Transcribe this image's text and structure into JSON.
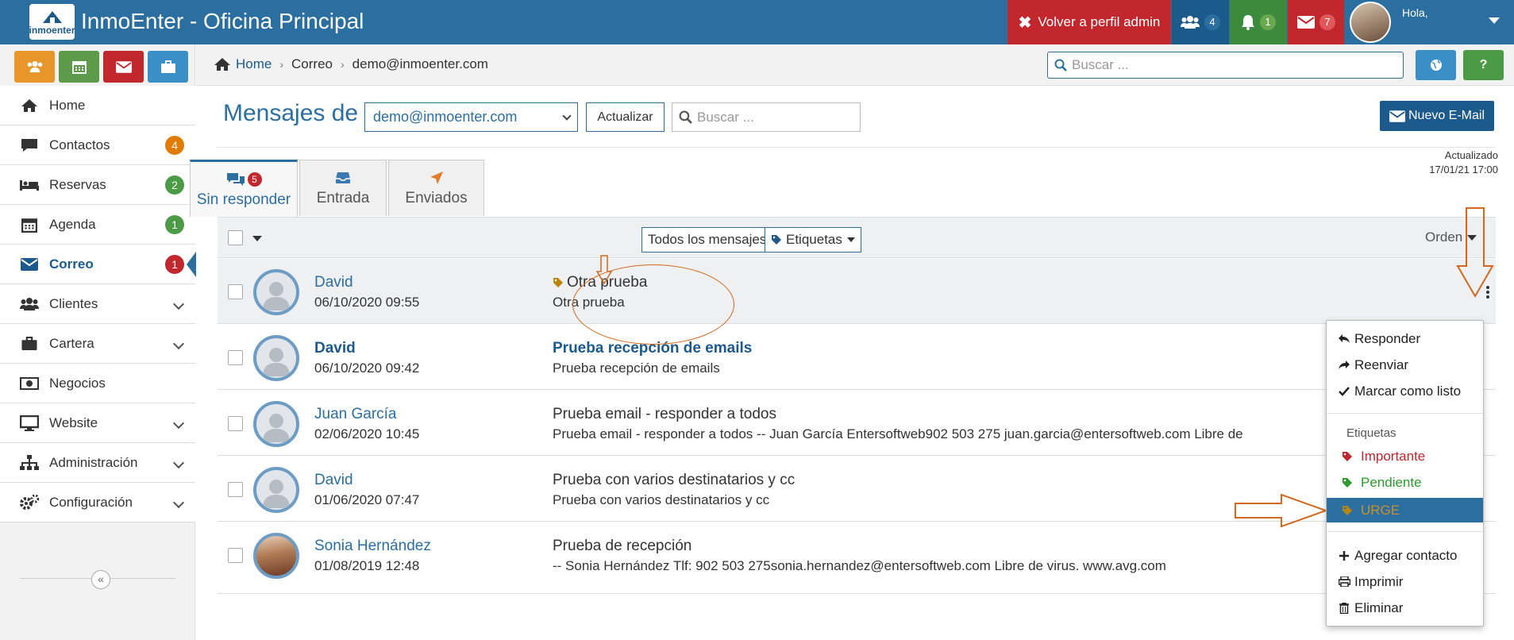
{
  "app": {
    "title": "InmoEnter - Oficina Principal",
    "logo_text": "inmoenter"
  },
  "topbar": {
    "admin_label": "Volver a perfil admin",
    "users_count": "4",
    "notif_count": "1",
    "mail_count": "7",
    "greeting": "Hola,"
  },
  "breadcrumb": {
    "home": "Home",
    "section": "Correo",
    "account": "demo@inmoenter.com"
  },
  "search": {
    "placeholder": "Buscar ..."
  },
  "help": {
    "label": "?"
  },
  "sidebar": {
    "items": [
      {
        "label": "Home"
      },
      {
        "label": "Contactos",
        "badge": "4",
        "badge_color": "#e07b00"
      },
      {
        "label": "Reservas",
        "badge": "2",
        "badge_color": "#4b9a45"
      },
      {
        "label": "Agenda",
        "badge": "1",
        "badge_color": "#4b9a45"
      },
      {
        "label": "Correo",
        "badge": "1",
        "badge_color": "#c1272d"
      },
      {
        "label": "Clientes"
      },
      {
        "label": "Cartera"
      },
      {
        "label": "Negocios"
      },
      {
        "label": "Website"
      },
      {
        "label": "Administración"
      },
      {
        "label": "Configuración"
      }
    ],
    "collapse_icon": "«"
  },
  "main": {
    "title": "Mensajes de",
    "account_select": "demo@inmoenter.com",
    "refresh_label": "Actualizar",
    "search_placeholder": "Buscar ...",
    "new_email_label": "Nuevo E-Mail",
    "tabs": [
      {
        "label": "Sin responder",
        "badge": "5"
      },
      {
        "label": "Entrada"
      },
      {
        "label": "Enviados"
      }
    ],
    "updated_label": "Actualizado",
    "updated_time": "17/01/21 17:00",
    "filter_all": "Todos los mensajes",
    "filter_tags": "Etiquetas",
    "order_label": "Orden"
  },
  "messages": [
    {
      "name": "David",
      "date": "06/10/2020 09:55",
      "subject": "Otra prueba",
      "preview": "Otra prueba"
    },
    {
      "name": "David",
      "date": "06/10/2020 09:42",
      "subject": "Prueba recepción de emails",
      "preview": "Prueba recepción de emails"
    },
    {
      "name": "Juan García",
      "date": "02/06/2020 10:45",
      "subject": "Prueba email - responder a todos",
      "preview": "Prueba email - responder a todos -- Juan García Entersoftweb902 503 275 juan.garcia@entersoftweb.com Libre de"
    },
    {
      "name": "David",
      "date": "01/06/2020 07:47",
      "subject": "Prueba con varios destinatarios y cc",
      "preview": "Prueba con varios destinatarios y cc"
    },
    {
      "name": "Sonia Hernández",
      "date": "01/08/2019 12:48",
      "subject": "Prueba de recepción",
      "preview": "-- Sonia Hernández Tlf: 902 503 275sonia.hernandez@entersoftweb.com Libre de virus. www.avg.com"
    }
  ],
  "context_menu": {
    "reply": "Responder",
    "forward": "Reenviar",
    "mark_done": "Marcar como listo",
    "tags_heading": "Etiquetas",
    "tag_important": "Importante",
    "tag_pending": "Pendiente",
    "tag_urgent": "URGE",
    "add_contact": "Agregar contacto",
    "print": "Imprimir",
    "delete": "Eliminar"
  },
  "colors": {
    "brand_blue": "#2b6ea0",
    "dark_blue": "#1d5a8c",
    "red": "#c1272d",
    "green": "#4b9a45",
    "orange": "#e07b00",
    "annotation": "#d2691e",
    "tag_important": "#c1272d",
    "tag_pending": "#2e9a2e",
    "tag_urgent": "#b8860b"
  }
}
